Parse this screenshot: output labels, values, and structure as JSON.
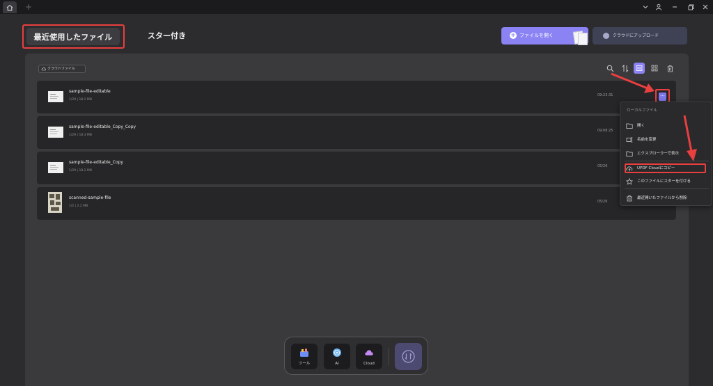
{
  "tabs": {
    "recent": "最近使用したファイル",
    "starred": "スター付き"
  },
  "header": {
    "open_file": "ファイルを開く",
    "upload_cloud": "クラウドにアップロード"
  },
  "filter": {
    "cloud_files": "クラウドファイル"
  },
  "files": [
    {
      "name": "sample-file-editable",
      "meta": "1/29 | 18.2 MB",
      "time": "09:23:31",
      "thumb": "doc"
    },
    {
      "name": "sample-file-editable_Copy_Copy",
      "meta": "1/29 | 18.3 MB",
      "time": "09:08:25",
      "thumb": "doc"
    },
    {
      "name": "sample-file-editable_Copy",
      "meta": "1/29 | 18.2 MB",
      "time": "05/26",
      "thumb": "doc"
    },
    {
      "name": "scanned-sample-file",
      "meta": "1/2 | 2.2 MB",
      "time": "05/26",
      "thumb": "scan"
    }
  ],
  "context_menu": {
    "header": "ローカルファイル",
    "items": {
      "open": "開く",
      "rename": "名前を変更",
      "explorer": "エクスプローラーで表示",
      "copy_cloud": "UPDF Cloudにコピー",
      "star": "このファイルにスターを付ける",
      "remove": "最近開いたファイルから削除"
    }
  },
  "dock": {
    "tools": "ツール",
    "ai": "AI",
    "cloud": "Cloud"
  },
  "colors": {
    "accent": "#8b82f3",
    "highlight": "#ea3f3f"
  }
}
